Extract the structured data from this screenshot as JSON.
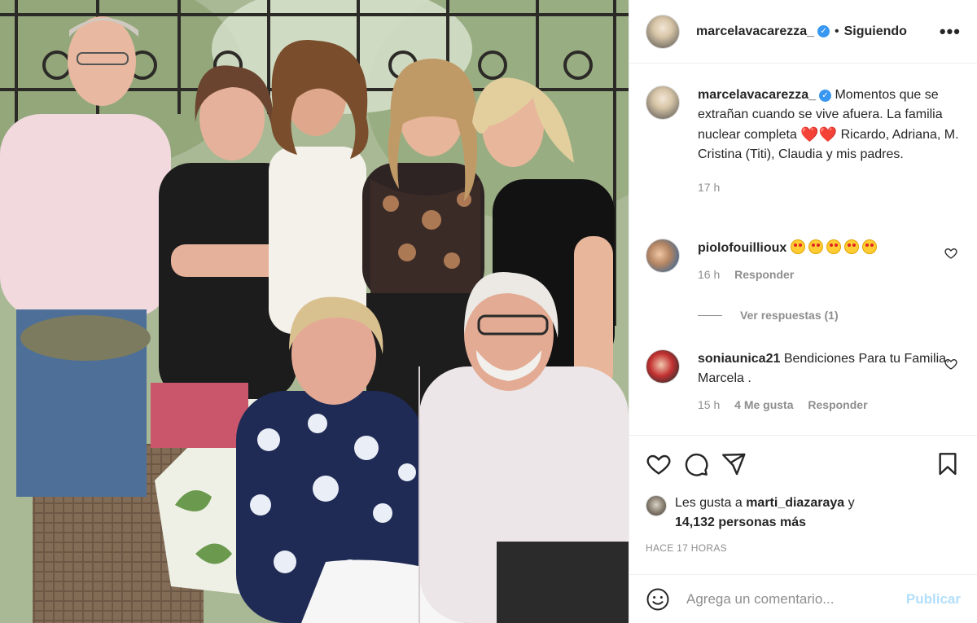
{
  "post": {
    "author": "marcelavacarezza_",
    "separator": "•",
    "follow_status": "Siguiendo",
    "more_label": "•••",
    "photo_alt": ""
  },
  "caption": {
    "username": "marcelavacarezza_",
    "text": "Momentos que se extrañan cuando se vive afuera. La familia nuclear completa",
    "hearts": "❤️❤️",
    "text_after": "Ricardo, Adriana, M. Cristina (Titi), Claudia y mis padres.",
    "time": "17 h"
  },
  "comments": [
    {
      "username": "piolofouillioux",
      "emoji_count": 5,
      "text": "",
      "time": "16 h",
      "likes": "",
      "reply_label": "Responder"
    },
    {
      "username": "soniaunica21",
      "text": "Bendiciones Para tu Familia. Marcela .",
      "time": "15 h",
      "likes": "4 Me gusta",
      "reply_label": "Responder"
    }
  ],
  "view_replies": "Ver respuestas (1)",
  "likes": {
    "prefix": "Les gusta a",
    "user": "marti_diazaraya",
    "connector": "y",
    "count": "14,132 personas más"
  },
  "timestamp": "HACE 17 HORAS",
  "comment_box": {
    "placeholder": "Agrega un comentario...",
    "publish_label": "Publicar"
  },
  "colors": {
    "verified": "#3897f0",
    "publish_disabled": "#b2dffc",
    "heart": "#e02424",
    "muted": "#8e8e8e"
  }
}
